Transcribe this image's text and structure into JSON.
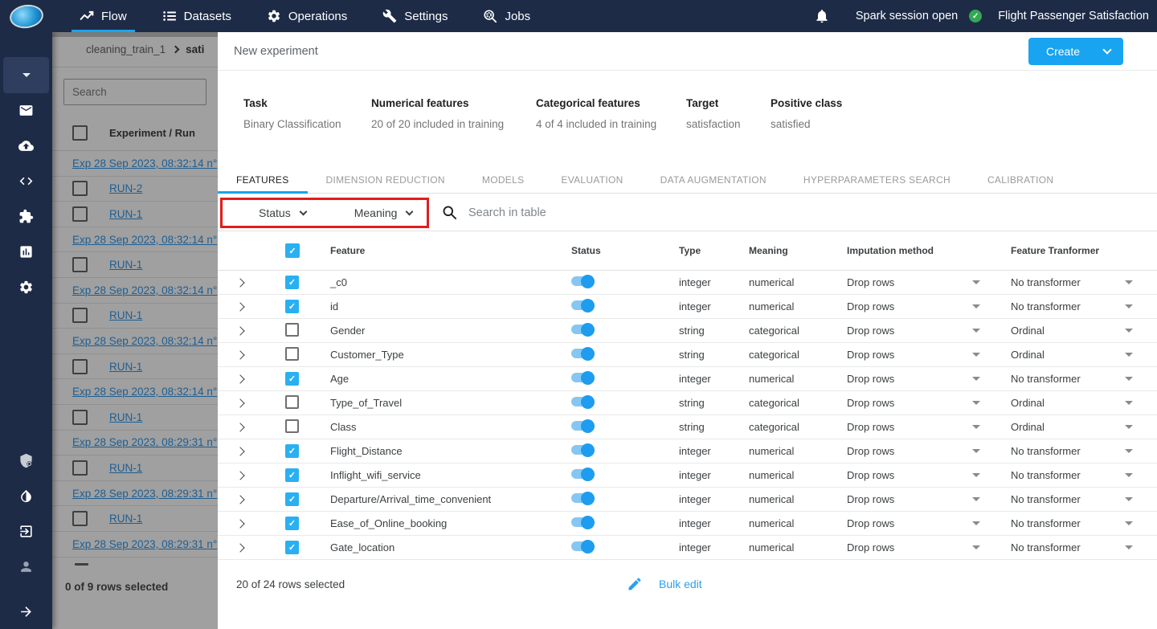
{
  "topnav": {
    "tabs": [
      {
        "label": "Flow",
        "active": true
      },
      {
        "label": "Datasets",
        "active": false
      },
      {
        "label": "Operations",
        "active": false
      },
      {
        "label": "Settings",
        "active": false
      },
      {
        "label": "Jobs",
        "active": false
      }
    ],
    "spark_status": "Spark session open",
    "project_title": "Flight Passenger Satisfaction"
  },
  "sidebar": {
    "icons": [
      "workspace-dropdown",
      "mail",
      "cloud-upload",
      "code",
      "extensions",
      "bar-chart",
      "settings-gear",
      "security-shield",
      "opacity-droplet",
      "exit-app",
      "user",
      "expand-arrow"
    ]
  },
  "left_panel": {
    "breadcrumb": {
      "parent": "cleaning_train_1",
      "current": "sati"
    },
    "search_placeholder": "Search",
    "header": "Experiment / Run",
    "rows": [
      {
        "kind": "experiment",
        "label": "Exp 28 Sep 2023, 08:32:14 n°"
      },
      {
        "kind": "run",
        "label": "RUN-2"
      },
      {
        "kind": "run",
        "label": "RUN-1"
      },
      {
        "kind": "experiment",
        "label": "Exp 28 Sep 2023, 08:32:14 n°"
      },
      {
        "kind": "run",
        "label": "RUN-1"
      },
      {
        "kind": "experiment",
        "label": "Exp 28 Sep 2023, 08:32:14 n°"
      },
      {
        "kind": "run",
        "label": "RUN-1"
      },
      {
        "kind": "experiment",
        "label": "Exp 28 Sep 2023, 08:32:14 n°"
      },
      {
        "kind": "run",
        "label": "RUN-1"
      },
      {
        "kind": "experiment",
        "label": "Exp 28 Sep 2023, 08:32:14 n°"
      },
      {
        "kind": "run",
        "label": "RUN-1"
      },
      {
        "kind": "experiment",
        "label": "Exp 28 Sep 2023, 08:29:31 n°"
      },
      {
        "kind": "run",
        "label": "RUN-1"
      },
      {
        "kind": "experiment",
        "label": "Exp 28 Sep 2023, 08:29:31 n°"
      },
      {
        "kind": "run",
        "label": "RUN-1"
      },
      {
        "kind": "experiment",
        "label": "Exp 28 Sep 2023, 08:29:31 n°"
      }
    ],
    "footer": "0 of 9 rows selected"
  },
  "main": {
    "title": "New experiment",
    "create_label": "Create",
    "summary": [
      {
        "label": "Task",
        "value": "Binary Classification"
      },
      {
        "label": "Numerical features",
        "value": "20 of 20 included in training"
      },
      {
        "label": "Categorical features",
        "value": "4 of 4 included in training"
      },
      {
        "label": "Target",
        "value": "satisfaction"
      },
      {
        "label": "Positive class",
        "value": "satisfied"
      }
    ],
    "tabs": [
      {
        "label": "FEATURES",
        "active": true
      },
      {
        "label": "DIMENSION REDUCTION",
        "active": false
      },
      {
        "label": "MODELS",
        "active": false
      },
      {
        "label": "EVALUATION",
        "active": false
      },
      {
        "label": "DATA AUGMENTATION",
        "active": false
      },
      {
        "label": "HYPERPARAMETERS SEARCH",
        "active": false
      },
      {
        "label": "CALIBRATION",
        "active": false
      }
    ],
    "filters": {
      "status_label": "Status",
      "meaning_label": "Meaning",
      "search_placeholder": "Search in table"
    },
    "table": {
      "columns": [
        "Feature",
        "Status",
        "Type",
        "Meaning",
        "Imputation method",
        "Feature Tranformer"
      ],
      "rows": [
        {
          "feature": "_c0",
          "checked": true,
          "status": true,
          "type": "integer",
          "meaning": "numerical",
          "imputation": "Drop rows",
          "transformer": "No transformer"
        },
        {
          "feature": "id",
          "checked": true,
          "status": true,
          "type": "integer",
          "meaning": "numerical",
          "imputation": "Drop rows",
          "transformer": "No transformer"
        },
        {
          "feature": "Gender",
          "checked": false,
          "status": true,
          "type": "string",
          "meaning": "categorical",
          "imputation": "Drop rows",
          "transformer": "Ordinal"
        },
        {
          "feature": "Customer_Type",
          "checked": false,
          "status": true,
          "type": "string",
          "meaning": "categorical",
          "imputation": "Drop rows",
          "transformer": "Ordinal"
        },
        {
          "feature": "Age",
          "checked": true,
          "status": true,
          "type": "integer",
          "meaning": "numerical",
          "imputation": "Drop rows",
          "transformer": "No transformer"
        },
        {
          "feature": "Type_of_Travel",
          "checked": false,
          "status": true,
          "type": "string",
          "meaning": "categorical",
          "imputation": "Drop rows",
          "transformer": "Ordinal"
        },
        {
          "feature": "Class",
          "checked": false,
          "status": true,
          "type": "string",
          "meaning": "categorical",
          "imputation": "Drop rows",
          "transformer": "Ordinal"
        },
        {
          "feature": "Flight_Distance",
          "checked": true,
          "status": true,
          "type": "integer",
          "meaning": "numerical",
          "imputation": "Drop rows",
          "transformer": "No transformer"
        },
        {
          "feature": "Inflight_wifi_service",
          "checked": true,
          "status": true,
          "type": "integer",
          "meaning": "numerical",
          "imputation": "Drop rows",
          "transformer": "No transformer"
        },
        {
          "feature": "Departure/Arrival_time_convenient",
          "checked": true,
          "status": true,
          "type": "integer",
          "meaning": "numerical",
          "imputation": "Drop rows",
          "transformer": "No transformer"
        },
        {
          "feature": "Ease_of_Online_booking",
          "checked": true,
          "status": true,
          "type": "integer",
          "meaning": "numerical",
          "imputation": "Drop rows",
          "transformer": "No transformer"
        },
        {
          "feature": "Gate_location",
          "checked": true,
          "status": true,
          "type": "integer",
          "meaning": "numerical",
          "imputation": "Drop rows",
          "transformer": "No transformer"
        }
      ],
      "selection_summary": "20 of 24 rows selected",
      "bulk_edit_label": "Bulk edit"
    }
  },
  "colors": {
    "accent": "#18a4f0",
    "annotation_red": "#e21d1d",
    "nav_bg": "#1d2b47",
    "success_green": "#34a853"
  }
}
